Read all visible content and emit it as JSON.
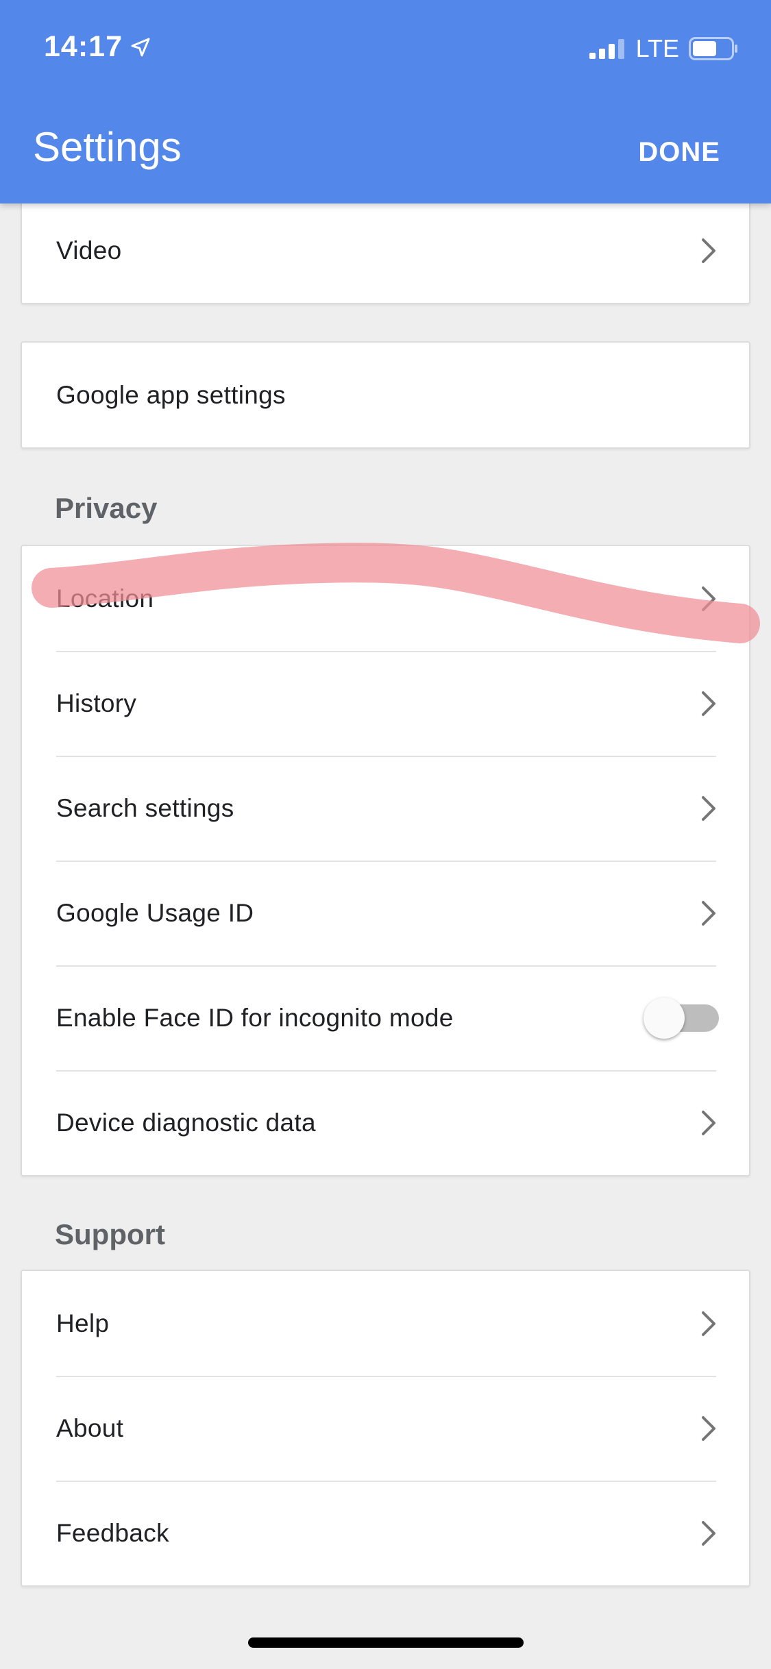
{
  "status_bar": {
    "time": "14:17",
    "network": "LTE",
    "location_icon": "location-arrow-icon",
    "signal_icon": "cellular-signal-icon",
    "battery_icon": "battery-icon"
  },
  "header": {
    "title": "Settings",
    "done_label": "DONE",
    "background_color": "#5487ea"
  },
  "cards": {
    "video": {
      "label": "Video"
    },
    "google_app_settings": {
      "label": "Google app settings"
    }
  },
  "privacy": {
    "heading": "Privacy",
    "items": [
      {
        "label": "Location"
      },
      {
        "label": "History"
      },
      {
        "label": "Search settings"
      },
      {
        "label": "Google Usage ID"
      },
      {
        "label": "Enable Face ID for incognito mode",
        "toggle": "off"
      },
      {
        "label": "Device diagnostic data"
      }
    ]
  },
  "support": {
    "heading": "Support",
    "items": [
      {
        "label": "Help"
      },
      {
        "label": "About"
      },
      {
        "label": "Feedback"
      }
    ]
  }
}
